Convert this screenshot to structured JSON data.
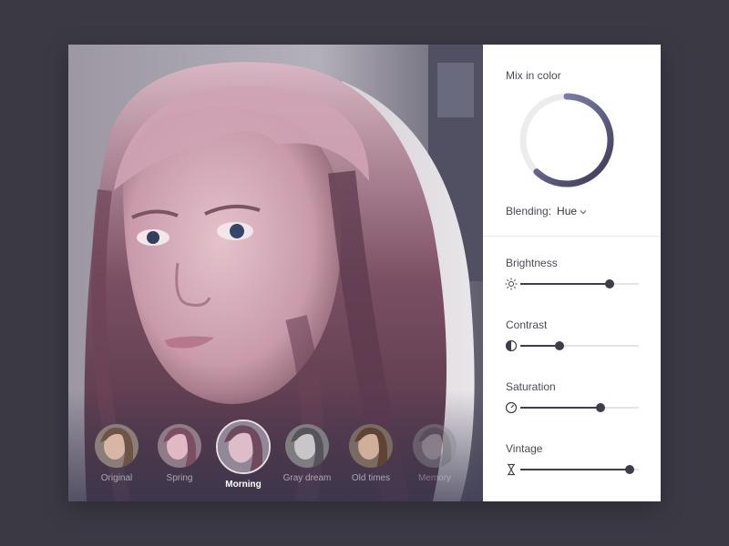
{
  "colors": {
    "background": "#3b3944",
    "panel": "#ffffff",
    "accent_dark": "#3e3d48",
    "ring_gradient_start": "#8e92c4",
    "ring_gradient_end": "#3b3850",
    "ring_track": "#ececef"
  },
  "photo": {
    "description_icon": "photo-girl-portrait"
  },
  "filters": [
    {
      "label": "Original",
      "active": false
    },
    {
      "label": "Spring",
      "active": false
    },
    {
      "label": "Morning",
      "active": true
    },
    {
      "label": "Gray dream",
      "active": false
    },
    {
      "label": "Old times",
      "active": false
    },
    {
      "label": "Memory",
      "active": false
    }
  ],
  "mix": {
    "title": "Mix in color",
    "amount": 0.62,
    "blending_label": "Blending:",
    "blending_value": "Hue"
  },
  "adjustments": {
    "brightness": {
      "label": "Brightness",
      "icon": "sun-icon",
      "value": 0.75
    },
    "contrast": {
      "label": "Contrast",
      "icon": "contrast-icon",
      "value": 0.33
    },
    "saturation": {
      "label": "Saturation",
      "icon": "gauge-icon",
      "value": 0.68
    },
    "vintage": {
      "label": "Vintage",
      "icon": "hourglass-icon",
      "value": 0.92
    }
  }
}
